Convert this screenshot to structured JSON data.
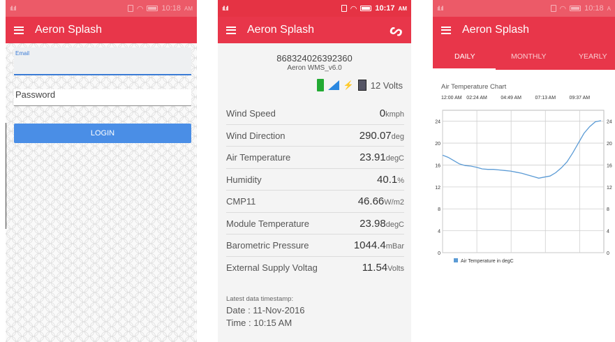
{
  "login": {
    "status_time": "10:18",
    "status_ampm": "AM",
    "app_title": "Aeron Splash",
    "email_label": "Email",
    "password_placeholder": "Password",
    "login_button": "LOGIN"
  },
  "dashboard": {
    "status_time": "10:17",
    "status_ampm": "AM",
    "app_title": "Aeron Splash",
    "device_id": "868324026392360",
    "device_version": "Aeron WMS_v6.0",
    "voltage_indicator": "12 Volts",
    "parameters": [
      {
        "name": "Wind Speed",
        "value": "0",
        "unit": "kmph"
      },
      {
        "name": "Wind Direction",
        "value": "290.07",
        "unit": "deg"
      },
      {
        "name": "Air Temperature",
        "value": "23.91",
        "unit": "degC"
      },
      {
        "name": "Humidity",
        "value": "40.1",
        "unit": "%"
      },
      {
        "name": "CMP11",
        "value": "46.66",
        "unit": "W/m2"
      },
      {
        "name": "Module Temperature",
        "value": "23.98",
        "unit": "degC"
      },
      {
        "name": "Barometric Pressure",
        "value": "1044.4",
        "unit": "mBar"
      },
      {
        "name": "External Supply Voltag",
        "value": "11.54",
        "unit": "Volts"
      }
    ],
    "timestamp_label": "Latest data timestamp:",
    "date_line": "Date : 11-Nov-2016",
    "time_line": "Time : 10:15 AM"
  },
  "chart_screen": {
    "status_time": "10:18",
    "status_ampm": "A",
    "app_title": "Aeron Splash",
    "tabs": [
      "DAILY",
      "MONTHLY",
      "YEARLY"
    ]
  },
  "colors": {
    "primary": "#e8364a",
    "line": "#5b9bd5",
    "login_button": "#4a8ee6"
  },
  "chart_data": {
    "type": "line",
    "title": "Air Temperature Chart",
    "x_tick_labels": [
      "12:00 AM",
      "02:24 AM",
      "04:49 AM",
      "07:13 AM",
      "09:37 AM"
    ],
    "x_range_hours": [
      0,
      11.4
    ],
    "ylim": [
      0,
      26
    ],
    "y_ticks": [
      0,
      4,
      8,
      12,
      16,
      20,
      24
    ],
    "grid": true,
    "legend_position": "bottom-left",
    "series": [
      {
        "name": "Air Temperature in degC",
        "x": [
          0,
          0.4,
          0.8,
          1.2,
          1.6,
          2.0,
          2.4,
          2.8,
          3.2,
          3.6,
          4.0,
          4.4,
          4.8,
          5.2,
          5.6,
          6.0,
          6.4,
          6.8,
          7.2,
          7.6,
          8.0,
          8.4,
          8.8,
          9.2,
          9.6,
          10.0,
          10.4,
          10.8,
          11.2
        ],
        "y": [
          17.8,
          17.4,
          16.8,
          16.2,
          15.9,
          15.8,
          15.6,
          15.3,
          15.2,
          15.2,
          15.1,
          15.0,
          14.9,
          14.7,
          14.5,
          14.2,
          13.9,
          13.6,
          13.8,
          14.0,
          14.6,
          15.5,
          16.6,
          18.2,
          20.0,
          21.8,
          23.0,
          23.9,
          24.1
        ]
      }
    ]
  }
}
